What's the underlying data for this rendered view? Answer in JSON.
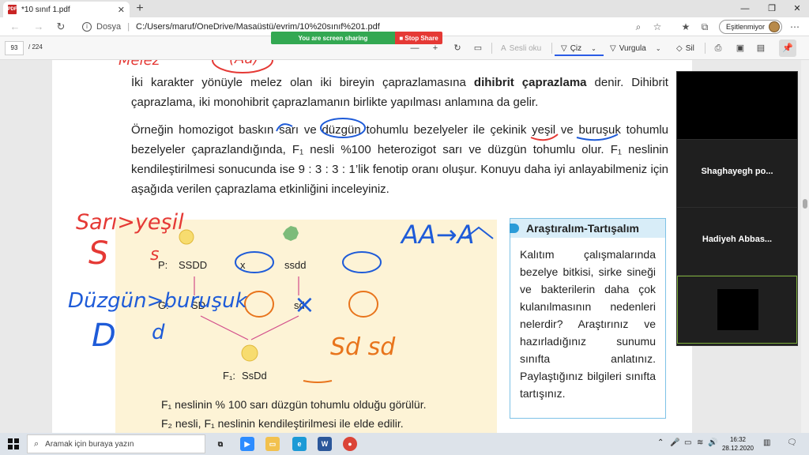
{
  "browser": {
    "tab_title": "*10 sınıf 1.pdf",
    "tab_icon_text": "PDF",
    "address_site": "Dosya",
    "address_url": "C:/Users/maruf/OneDrive/Masaüstü/evrim/10%20sınıf%201.pdf",
    "profile_label": "Eşitlenmiyor"
  },
  "pdf_toolbar": {
    "current_page": "93",
    "total_pages": "/ 224",
    "read_aloud": "Sesli oku",
    "draw": "Çiz",
    "highlight": "Vurgula",
    "erase": "Sil"
  },
  "screen_share": {
    "status": "You are screen sharing",
    "stop_label": "Stop Share"
  },
  "document": {
    "para1_a": "İki karakter yönüyle melez olan iki bireyin çaprazlamasına ",
    "para1_bold": "dihibrit çaprazlama",
    "para1_b": " denir. Dihibrit çaprazlama, iki monohibrit çaprazlamanın birlikte yapılması anlamına da gelir.",
    "para2": "Örneğin homozigot baskın sarı ve düzgün tohumlu bezelyeler ile çekinik yeşil ve buruşuk tohumlu bezelyeler çaprazlandığında, F₁ nesli %100 heterozigot sarı ve düzgün tohumlu olur. F₁ neslinin kendileştirilmesi sonucunda ise 9 : 3 : 3 : 1’lik fenotip oranı oluşur. Konuyu daha iyi anlayabilmeniz için aşağıda verilen çaprazlama etkinliğini inceleyiniz.",
    "diagram": {
      "p_label": "P:",
      "p_left": "SSDD",
      "cross": "x",
      "p_right": "ssdd",
      "g_label": "G:",
      "g_left": "SD",
      "g_right": "sd",
      "f1_label": "F₁:",
      "f1_value": "SsDd"
    },
    "caption1": "F₁ neslinin % 100 sarı düzgün tohumlu olduğu görülür.",
    "caption2": "F₂ nesli, F₁ neslinin kendileştirilmesi ile elde edilir.",
    "side_title": "Araştıralım-Tartışalım",
    "side_body": "Kalıtım çalışmalarında bezelye bitkisi, sirke sineği ve bakterilerin daha çok kulanılmasının nedenleri nelerdir? Araştırınız ve hazırladığınız sunumu sınıfta anlatınız. Paylaştığınız bilgileri sınıfta tartışınız."
  },
  "annotations": {
    "top_red": "Melez",
    "top_red2": "(Aa)",
    "sari_yesil": "Sarı>yeşil",
    "big_S": "S",
    "small_s": "s",
    "duzgun_burusuk": "Düzgün>buruşuk",
    "big_D": "D",
    "small_d": "d",
    "blue_aa": "AA→A",
    "blue_x": "×",
    "red_sd": "Sd sd"
  },
  "participants": [
    {
      "name": ""
    },
    {
      "name": "Shaghayegh po..."
    },
    {
      "name": "Hadiyeh Abbas..."
    },
    {
      "name": ""
    }
  ],
  "taskbar": {
    "search_placeholder": "Aramak için buraya yazın",
    "time": "16:32",
    "date": "28.12.2020"
  },
  "colors": {
    "annotation_red": "#e53935",
    "annotation_blue": "#1e5bd8",
    "annotation_orange": "#e8741c",
    "accent_blue": "#2b5ce6"
  }
}
